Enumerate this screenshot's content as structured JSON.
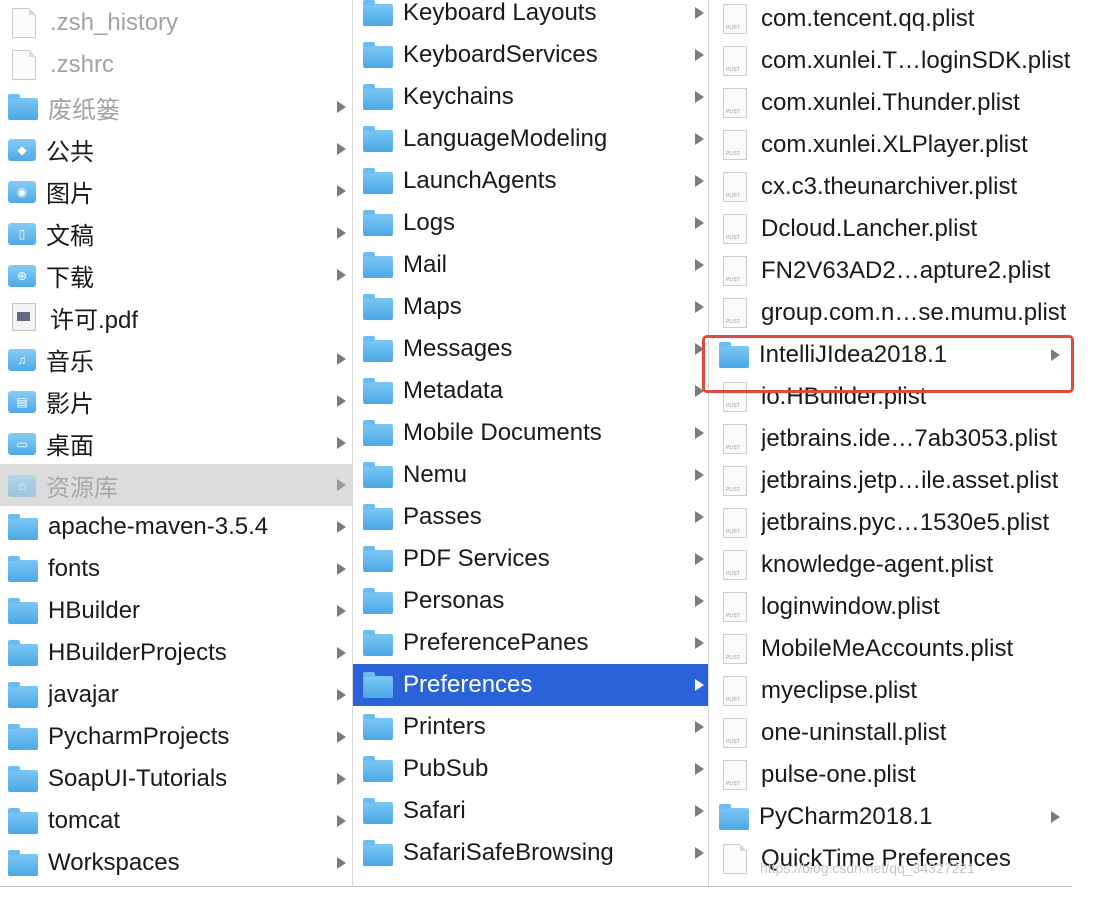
{
  "column1": [
    {
      "label": ".zsh_history",
      "icon": "document-icon",
      "state": "dim",
      "arrow": false
    },
    {
      "label": ".zshrc",
      "icon": "document-icon",
      "state": "dim",
      "arrow": false
    },
    {
      "label": "废纸篓",
      "icon": "folder-icon",
      "state": "dim",
      "arrow": true
    },
    {
      "label": "公共",
      "icon": "public-folder-icon",
      "state": "normal",
      "arrow": true
    },
    {
      "label": "图片",
      "icon": "pictures-folder-icon",
      "state": "normal",
      "arrow": true
    },
    {
      "label": "文稿",
      "icon": "documents-folder-icon",
      "state": "normal",
      "arrow": true
    },
    {
      "label": "下载",
      "icon": "downloads-folder-icon",
      "state": "normal",
      "arrow": true
    },
    {
      "label": "许可.pdf",
      "icon": "pdf-icon",
      "state": "normal",
      "arrow": false
    },
    {
      "label": "音乐",
      "icon": "music-folder-icon",
      "state": "normal",
      "arrow": true
    },
    {
      "label": "影片",
      "icon": "movies-folder-icon",
      "state": "normal",
      "arrow": true
    },
    {
      "label": "桌面",
      "icon": "desktop-folder-icon",
      "state": "normal",
      "arrow": true
    },
    {
      "label": "资源库",
      "icon": "library-folder-icon",
      "state": "selected-inactive",
      "arrow": true
    },
    {
      "label": "apache-maven-3.5.4",
      "icon": "folder-icon",
      "state": "normal",
      "arrow": true
    },
    {
      "label": "fonts",
      "icon": "folder-icon",
      "state": "normal",
      "arrow": true
    },
    {
      "label": "HBuilder",
      "icon": "folder-icon",
      "state": "normal",
      "arrow": true
    },
    {
      "label": "HBuilderProjects",
      "icon": "folder-icon",
      "state": "normal",
      "arrow": true
    },
    {
      "label": "javajar",
      "icon": "folder-icon",
      "state": "normal",
      "arrow": true
    },
    {
      "label": "PycharmProjects",
      "icon": "folder-icon",
      "state": "normal",
      "arrow": true
    },
    {
      "label": "SoapUI-Tutorials",
      "icon": "folder-icon",
      "state": "normal",
      "arrow": true
    },
    {
      "label": "tomcat",
      "icon": "folder-icon",
      "state": "normal",
      "arrow": true
    },
    {
      "label": "Workspaces",
      "icon": "folder-icon",
      "state": "normal",
      "arrow": true
    }
  ],
  "column2": [
    {
      "label": "Keyboard Layouts",
      "icon": "folder-icon",
      "state": "normal",
      "arrow": true
    },
    {
      "label": "KeyboardServices",
      "icon": "folder-icon",
      "state": "normal",
      "arrow": true
    },
    {
      "label": "Keychains",
      "icon": "folder-icon",
      "state": "normal",
      "arrow": true
    },
    {
      "label": "LanguageModeling",
      "icon": "folder-icon",
      "state": "normal",
      "arrow": true
    },
    {
      "label": "LaunchAgents",
      "icon": "folder-icon",
      "state": "normal",
      "arrow": true
    },
    {
      "label": "Logs",
      "icon": "folder-icon",
      "state": "normal",
      "arrow": true
    },
    {
      "label": "Mail",
      "icon": "folder-icon",
      "state": "normal",
      "arrow": true
    },
    {
      "label": "Maps",
      "icon": "folder-icon",
      "state": "normal",
      "arrow": true
    },
    {
      "label": "Messages",
      "icon": "folder-icon",
      "state": "normal",
      "arrow": true
    },
    {
      "label": "Metadata",
      "icon": "folder-icon",
      "state": "normal",
      "arrow": true
    },
    {
      "label": "Mobile Documents",
      "icon": "folder-icon",
      "state": "normal",
      "arrow": true
    },
    {
      "label": "Nemu",
      "icon": "folder-icon",
      "state": "normal",
      "arrow": true
    },
    {
      "label": "Passes",
      "icon": "folder-icon",
      "state": "normal",
      "arrow": true
    },
    {
      "label": "PDF Services",
      "icon": "folder-icon",
      "state": "normal",
      "arrow": true
    },
    {
      "label": "Personas",
      "icon": "folder-icon",
      "state": "normal",
      "arrow": true
    },
    {
      "label": "PreferencePanes",
      "icon": "folder-icon",
      "state": "normal",
      "arrow": true
    },
    {
      "label": "Preferences",
      "icon": "folder-icon",
      "state": "selected",
      "arrow": true
    },
    {
      "label": "Printers",
      "icon": "folder-icon",
      "state": "normal",
      "arrow": true
    },
    {
      "label": "PubSub",
      "icon": "folder-icon",
      "state": "normal",
      "arrow": true
    },
    {
      "label": "Safari",
      "icon": "folder-icon",
      "state": "normal",
      "arrow": true
    },
    {
      "label": "SafariSafeBrowsing",
      "icon": "folder-icon",
      "state": "normal",
      "arrow": true
    }
  ],
  "column3": [
    {
      "label": "com.tencent.qq.plist",
      "icon": "plist-icon",
      "state": "normal",
      "arrow": false
    },
    {
      "label": "com.xunlei.T…loginSDK.plist",
      "icon": "plist-icon",
      "state": "normal",
      "arrow": false
    },
    {
      "label": "com.xunlei.Thunder.plist",
      "icon": "plist-icon",
      "state": "normal",
      "arrow": false
    },
    {
      "label": "com.xunlei.XLPlayer.plist",
      "icon": "plist-icon",
      "state": "normal",
      "arrow": false
    },
    {
      "label": "cx.c3.theunarchiver.plist",
      "icon": "plist-icon",
      "state": "normal",
      "arrow": false
    },
    {
      "label": "Dcloud.Lancher.plist",
      "icon": "plist-icon",
      "state": "normal",
      "arrow": false
    },
    {
      "label": "FN2V63AD2…apture2.plist",
      "icon": "plist-icon",
      "state": "normal",
      "arrow": false
    },
    {
      "label": "group.com.n…se.mumu.plist",
      "icon": "plist-icon",
      "state": "normal",
      "arrow": false
    },
    {
      "label": "IntelliJIdea2018.1",
      "icon": "folder-icon",
      "state": "normal",
      "arrow": true
    },
    {
      "label": "io.HBuilder.plist",
      "icon": "plist-icon",
      "state": "normal",
      "arrow": false
    },
    {
      "label": "jetbrains.ide…7ab3053.plist",
      "icon": "plist-icon",
      "state": "normal",
      "arrow": false
    },
    {
      "label": "jetbrains.jetp…ile.asset.plist",
      "icon": "plist-icon",
      "state": "normal",
      "arrow": false
    },
    {
      "label": "jetbrains.pyc…1530e5.plist",
      "icon": "plist-icon",
      "state": "normal",
      "arrow": false
    },
    {
      "label": "knowledge-agent.plist",
      "icon": "plist-icon",
      "state": "normal",
      "arrow": false
    },
    {
      "label": "loginwindow.plist",
      "icon": "plist-icon",
      "state": "normal",
      "arrow": false
    },
    {
      "label": "MobileMeAccounts.plist",
      "icon": "plist-icon",
      "state": "normal",
      "arrow": false
    },
    {
      "label": "myeclipse.plist",
      "icon": "plist-icon",
      "state": "normal",
      "arrow": false
    },
    {
      "label": "one-uninstall.plist",
      "icon": "plist-icon",
      "state": "normal",
      "arrow": false
    },
    {
      "label": "pulse-one.plist",
      "icon": "plist-icon",
      "state": "normal",
      "arrow": false
    },
    {
      "label": "PyCharm2018.1",
      "icon": "folder-icon",
      "state": "normal",
      "arrow": true
    },
    {
      "label": "QuickTime Preferences",
      "icon": "document-icon",
      "state": "normal",
      "arrow": false
    }
  ],
  "watermark": "https://blog.csdn.net/qq_34327221",
  "colors": {
    "selection": "#2a62d9",
    "highlight_box": "#e0493b",
    "folder": "#5ab6f0"
  }
}
